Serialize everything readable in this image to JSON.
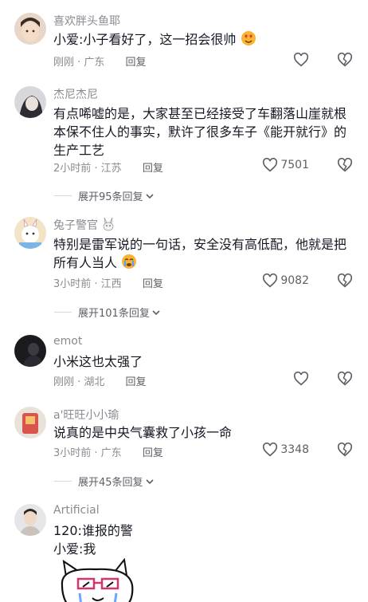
{
  "comments": [
    {
      "user": "喜欢胖头鱼耶",
      "text": "小爱:小子看好了，这一招会很帅",
      "emoji": "heart-eyes-emoji",
      "time_loc": "刚刚 · 广东",
      "reply": "回复",
      "likes": ""
    },
    {
      "user": "杰尼杰尼",
      "text": "有点唏嘘的是，大家甚至已经接受了车翻落山崖就根本保不住人的事实，默许了很多车子《能开就行》的生产工艺",
      "time_loc": "2小时前 · 江苏",
      "reply": "回复",
      "likes": "7501",
      "expand": "展开95条回复"
    },
    {
      "user": "兔子警官",
      "user_badge": "rabbit-emoji",
      "text": "特别是雷军说的一句话，安全没有高低配，他就是把所有人当人",
      "emoji": "crying-emoji",
      "time_loc": "3小时前 · 江西",
      "reply": "回复",
      "likes": "9082",
      "expand": "展开101条回复"
    },
    {
      "user": "emot",
      "text": "小米这也太强了",
      "time_loc": "刚刚 · 湖北",
      "reply": "回复",
      "likes": ""
    },
    {
      "user": "a'旺旺小小瑜",
      "text": "说真的是中央气囊救了小孩一命",
      "time_loc": "3小时前 · 广东",
      "reply": "回复",
      "likes": "3348",
      "expand": "展开45条回复"
    },
    {
      "user": "Artificial",
      "text_line1": "120:谁报的警",
      "text_line2": "小爱:我",
      "sticker": "cat-sticker"
    }
  ],
  "colors": {
    "text": "#161823",
    "muted": "#8a8b91",
    "secondary": "#5e5f66"
  },
  "icons": {
    "like": "heart-outline-icon",
    "dislike": "broken-heart-icon",
    "expand": "chevron-down-icon"
  }
}
